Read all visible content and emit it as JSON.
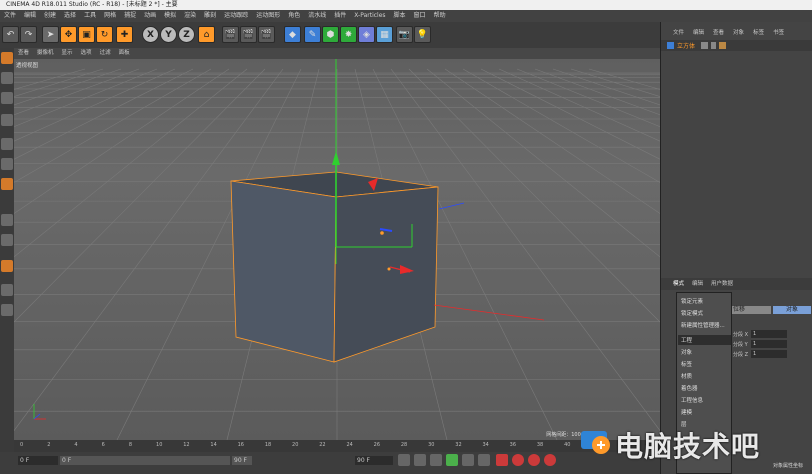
{
  "window": {
    "title": "CINEMA 4D R18.011 Studio (RC - R18) - [未标题 2 *] - 主要"
  },
  "menubar": {
    "items": [
      "文件",
      "编辑",
      "创建",
      "选择",
      "工具",
      "网格",
      "捕捉",
      "动画",
      "模拟",
      "渲染",
      "雕刻",
      "运动跟踪",
      "运动图形",
      "角色",
      "流水线",
      "插件",
      "X-Particles",
      "脚本",
      "窗口",
      "帮助"
    ]
  },
  "viewport": {
    "menu": [
      "查看",
      "摄像机",
      "显示",
      "选项",
      "过滤",
      "面板"
    ],
    "label": "透视视图",
    "grid_label": "网格间距：100 cm"
  },
  "timeline": {
    "ticks": [
      "0",
      "2",
      "4",
      "6",
      "8",
      "10",
      "12",
      "14",
      "16",
      "18",
      "20",
      "22",
      "24",
      "26",
      "28",
      "30",
      "32",
      "34",
      "36",
      "38",
      "40",
      "42",
      "44"
    ],
    "start_frame": "0 F",
    "field2": "0 F",
    "end_field": "90 F",
    "end_frame": "90 F"
  },
  "object_manager": {
    "menu": [
      "文件",
      "编辑",
      "查看",
      "对象",
      "标签",
      "书签"
    ],
    "object_name": "立方体"
  },
  "attribute_manager": {
    "tabs": [
      "模式",
      "编辑",
      "用户数据"
    ],
    "tab_active_label": "对象",
    "coord_labels": [
      "位移",
      "X",
      "Y",
      "Z"
    ],
    "rows": [
      {
        "label": "分段 X",
        "value": "1"
      },
      {
        "label": "分段 Y",
        "value": "1"
      },
      {
        "label": "分段 Z",
        "value": "1"
      }
    ]
  },
  "context_menu": {
    "items": [
      "锁定元素",
      "锁定模式",
      "新建属性管理器...",
      "工程",
      "对象",
      "标签",
      "材质",
      "着色器",
      "工程信息",
      "建模",
      "层"
    ],
    "highlighted_index": 3,
    "checked_index": 4
  },
  "bottom_labels": [
    "对象属性",
    "坐标"
  ],
  "watermark": {
    "text": "电脑技术吧"
  },
  "colors": {
    "accent_orange": "#ff9a2a",
    "axis_green": "#2fd02f",
    "axis_red": "#e82a2a",
    "axis_blue": "#2a4bff",
    "cube_face": "#4a5360"
  }
}
